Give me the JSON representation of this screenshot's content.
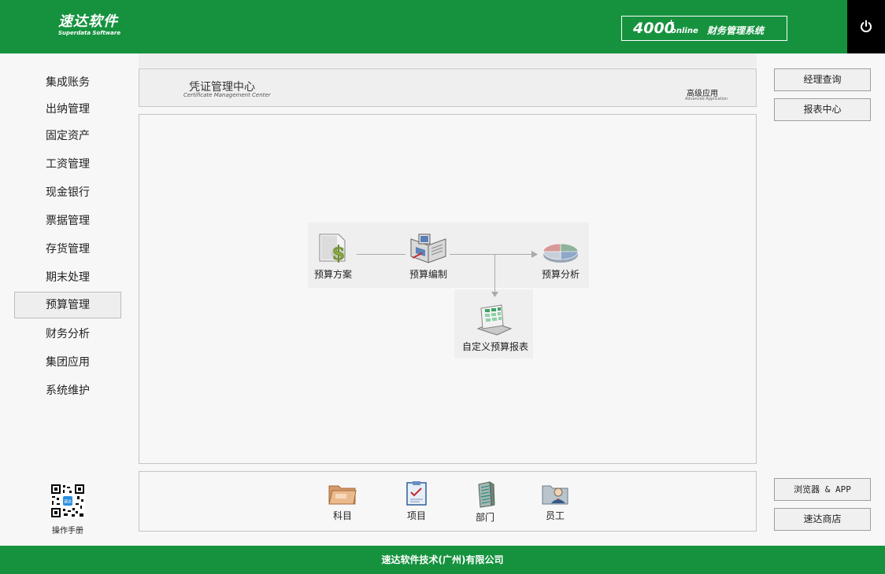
{
  "header": {
    "logo_cn": "速达软件",
    "logo_en": "Superdata Software",
    "hotline_number": "4000",
    "hotline_plus": "+",
    "hotline_suffix": "online",
    "system_name": "财务管理系统"
  },
  "sidebar": {
    "items": [
      {
        "label": "集成账务"
      },
      {
        "label": "出纳管理"
      },
      {
        "label": "固定资产"
      },
      {
        "label": "工资管理"
      },
      {
        "label": "现金银行"
      },
      {
        "label": "票据管理"
      },
      {
        "label": "存货管理"
      },
      {
        "label": "期末处理"
      },
      {
        "label": "预算管理",
        "active": true
      },
      {
        "label": "财务分析"
      },
      {
        "label": "集团应用"
      },
      {
        "label": "系统维护"
      }
    ],
    "manual_label": "操作手册"
  },
  "banner": {
    "title": "凭证管理中心",
    "subtitle": "Certificate Management Center",
    "advanced": "高级应用",
    "advanced_sub": "Advanced Application"
  },
  "workflow": {
    "nodes": [
      {
        "label": "预算方案",
        "icon": "dollar-document-icon"
      },
      {
        "label": "预算编制",
        "icon": "budget-book-icon"
      },
      {
        "label": "预算分析",
        "icon": "pie-chart-icon"
      },
      {
        "label": "自定义预算报表",
        "icon": "report-sheet-icon"
      }
    ]
  },
  "bottom_bar": {
    "items": [
      {
        "label": "科目",
        "icon": "folder-icon"
      },
      {
        "label": "项目",
        "icon": "clipboard-icon"
      },
      {
        "label": "部门",
        "icon": "building-icon"
      },
      {
        "label": "员工",
        "icon": "employee-icon"
      }
    ]
  },
  "right_panel": {
    "manager_query": "经理查询",
    "report_center": "报表中心",
    "browser_app": "浏览器 & APP",
    "store": "速达商店"
  },
  "footer": {
    "text": "速达软件技术(广州)有限公司"
  },
  "colors": {
    "brand_green": "#16923f",
    "power_bg": "#000000"
  }
}
